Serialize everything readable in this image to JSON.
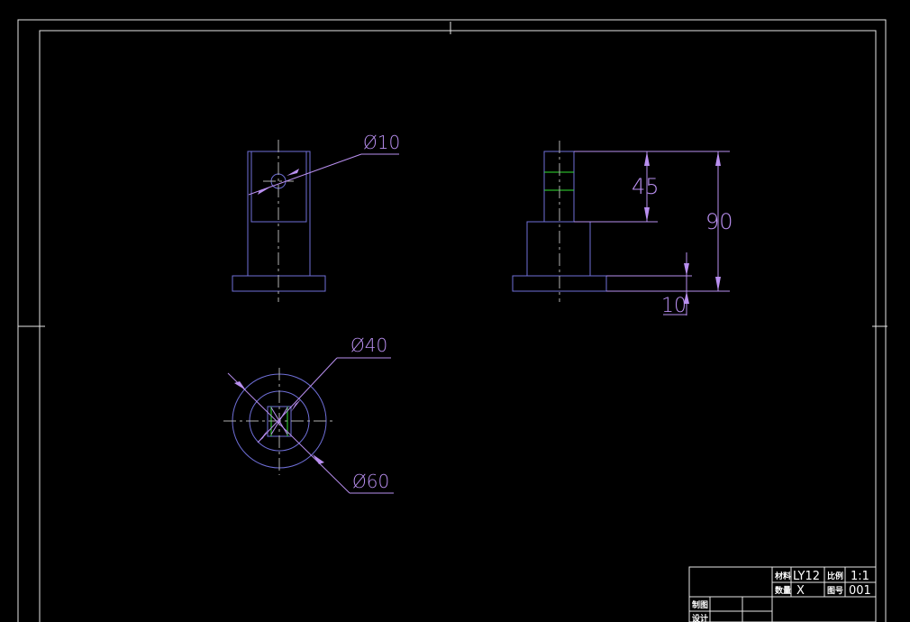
{
  "dimensions": {
    "front_hole_diameter": "Ø10",
    "side_height_upper": "45",
    "side_height_total": "90",
    "side_base_thickness": "10",
    "top_inner_diameter": "Ø40",
    "top_outer_diameter": "Ø60"
  },
  "title_block": {
    "material_label": "材料",
    "material_value": "LY12",
    "scale_label": "比例",
    "scale_value": "1:1",
    "quantity_label": "数量",
    "quantity_value": "X",
    "drawing_no_label": "图号",
    "drawing_no_value": "001",
    "drawn_label": "制图",
    "designed_label": "设计"
  },
  "colors": {
    "background": "#000000",
    "outline": "#6f6fd8",
    "dimension": "#b98ff0",
    "centerline": "#b0b0b0",
    "hatch": "#33e033",
    "border": "#e6e6e6"
  }
}
